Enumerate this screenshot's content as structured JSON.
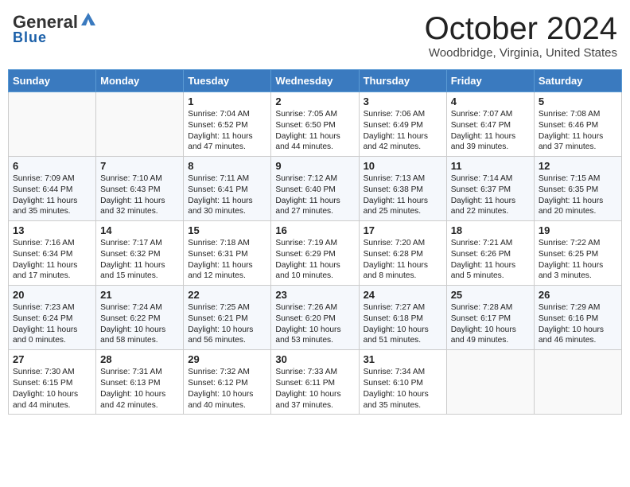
{
  "header": {
    "logo_general": "General",
    "logo_blue": "Blue",
    "title": "October 2024",
    "location": "Woodbridge, Virginia, United States"
  },
  "days_of_week": [
    "Sunday",
    "Monday",
    "Tuesday",
    "Wednesday",
    "Thursday",
    "Friday",
    "Saturday"
  ],
  "weeks": [
    [
      {
        "day": "",
        "text": ""
      },
      {
        "day": "",
        "text": ""
      },
      {
        "day": "1",
        "text": "Sunrise: 7:04 AM\nSunset: 6:52 PM\nDaylight: 11 hours and 47 minutes."
      },
      {
        "day": "2",
        "text": "Sunrise: 7:05 AM\nSunset: 6:50 PM\nDaylight: 11 hours and 44 minutes."
      },
      {
        "day": "3",
        "text": "Sunrise: 7:06 AM\nSunset: 6:49 PM\nDaylight: 11 hours and 42 minutes."
      },
      {
        "day": "4",
        "text": "Sunrise: 7:07 AM\nSunset: 6:47 PM\nDaylight: 11 hours and 39 minutes."
      },
      {
        "day": "5",
        "text": "Sunrise: 7:08 AM\nSunset: 6:46 PM\nDaylight: 11 hours and 37 minutes."
      }
    ],
    [
      {
        "day": "6",
        "text": "Sunrise: 7:09 AM\nSunset: 6:44 PM\nDaylight: 11 hours and 35 minutes."
      },
      {
        "day": "7",
        "text": "Sunrise: 7:10 AM\nSunset: 6:43 PM\nDaylight: 11 hours and 32 minutes."
      },
      {
        "day": "8",
        "text": "Sunrise: 7:11 AM\nSunset: 6:41 PM\nDaylight: 11 hours and 30 minutes."
      },
      {
        "day": "9",
        "text": "Sunrise: 7:12 AM\nSunset: 6:40 PM\nDaylight: 11 hours and 27 minutes."
      },
      {
        "day": "10",
        "text": "Sunrise: 7:13 AM\nSunset: 6:38 PM\nDaylight: 11 hours and 25 minutes."
      },
      {
        "day": "11",
        "text": "Sunrise: 7:14 AM\nSunset: 6:37 PM\nDaylight: 11 hours and 22 minutes."
      },
      {
        "day": "12",
        "text": "Sunrise: 7:15 AM\nSunset: 6:35 PM\nDaylight: 11 hours and 20 minutes."
      }
    ],
    [
      {
        "day": "13",
        "text": "Sunrise: 7:16 AM\nSunset: 6:34 PM\nDaylight: 11 hours and 17 minutes."
      },
      {
        "day": "14",
        "text": "Sunrise: 7:17 AM\nSunset: 6:32 PM\nDaylight: 11 hours and 15 minutes."
      },
      {
        "day": "15",
        "text": "Sunrise: 7:18 AM\nSunset: 6:31 PM\nDaylight: 11 hours and 12 minutes."
      },
      {
        "day": "16",
        "text": "Sunrise: 7:19 AM\nSunset: 6:29 PM\nDaylight: 11 hours and 10 minutes."
      },
      {
        "day": "17",
        "text": "Sunrise: 7:20 AM\nSunset: 6:28 PM\nDaylight: 11 hours and 8 minutes."
      },
      {
        "day": "18",
        "text": "Sunrise: 7:21 AM\nSunset: 6:26 PM\nDaylight: 11 hours and 5 minutes."
      },
      {
        "day": "19",
        "text": "Sunrise: 7:22 AM\nSunset: 6:25 PM\nDaylight: 11 hours and 3 minutes."
      }
    ],
    [
      {
        "day": "20",
        "text": "Sunrise: 7:23 AM\nSunset: 6:24 PM\nDaylight: 11 hours and 0 minutes."
      },
      {
        "day": "21",
        "text": "Sunrise: 7:24 AM\nSunset: 6:22 PM\nDaylight: 10 hours and 58 minutes."
      },
      {
        "day": "22",
        "text": "Sunrise: 7:25 AM\nSunset: 6:21 PM\nDaylight: 10 hours and 56 minutes."
      },
      {
        "day": "23",
        "text": "Sunrise: 7:26 AM\nSunset: 6:20 PM\nDaylight: 10 hours and 53 minutes."
      },
      {
        "day": "24",
        "text": "Sunrise: 7:27 AM\nSunset: 6:18 PM\nDaylight: 10 hours and 51 minutes."
      },
      {
        "day": "25",
        "text": "Sunrise: 7:28 AM\nSunset: 6:17 PM\nDaylight: 10 hours and 49 minutes."
      },
      {
        "day": "26",
        "text": "Sunrise: 7:29 AM\nSunset: 6:16 PM\nDaylight: 10 hours and 46 minutes."
      }
    ],
    [
      {
        "day": "27",
        "text": "Sunrise: 7:30 AM\nSunset: 6:15 PM\nDaylight: 10 hours and 44 minutes."
      },
      {
        "day": "28",
        "text": "Sunrise: 7:31 AM\nSunset: 6:13 PM\nDaylight: 10 hours and 42 minutes."
      },
      {
        "day": "29",
        "text": "Sunrise: 7:32 AM\nSunset: 6:12 PM\nDaylight: 10 hours and 40 minutes."
      },
      {
        "day": "30",
        "text": "Sunrise: 7:33 AM\nSunset: 6:11 PM\nDaylight: 10 hours and 37 minutes."
      },
      {
        "day": "31",
        "text": "Sunrise: 7:34 AM\nSunset: 6:10 PM\nDaylight: 10 hours and 35 minutes."
      },
      {
        "day": "",
        "text": ""
      },
      {
        "day": "",
        "text": ""
      }
    ]
  ]
}
